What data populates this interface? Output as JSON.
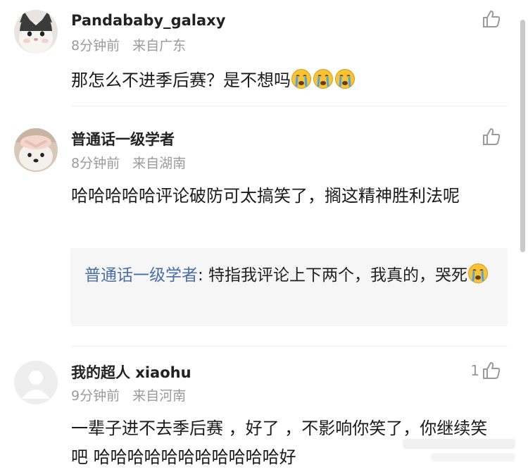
{
  "comments": [
    {
      "username": "Pandababy_galaxy",
      "time": "8分钟前",
      "location": "来自广东",
      "text": "那怎么不进季后赛？是不想吗",
      "emojis": [
        "crying-emoji",
        "crying-emoji",
        "crying-emoji"
      ],
      "avatar": "cat-avatar",
      "like_count": ""
    },
    {
      "username": "普通话一级学者",
      "time": "8分钟前",
      "location": "来自湖南",
      "text": "哈哈哈哈哈评论破防可太搞笑了，搁这精神胜利法呢",
      "avatar": "dog-avatar",
      "like_count": "",
      "reply": {
        "author": "普通话一级学者",
        "text": ": 特指我评论上下两个，我真的，哭死",
        "emojis": [
          "crying-emoji"
        ]
      }
    },
    {
      "username": "我的超人 xiaohu",
      "time": "9分钟前",
      "location": "来自河南",
      "text": "一辈子进不去季后赛 ，好了 ，不影响你笑了，你继续笑吧  哈哈哈哈哈哈哈哈哈哈哈好",
      "avatar": "default-avatar",
      "like_count": "1"
    }
  ],
  "colors": {
    "reply_author": "#4a6ea8",
    "meta": "#9a9a9a",
    "reply_background": "#f6f6f6"
  }
}
